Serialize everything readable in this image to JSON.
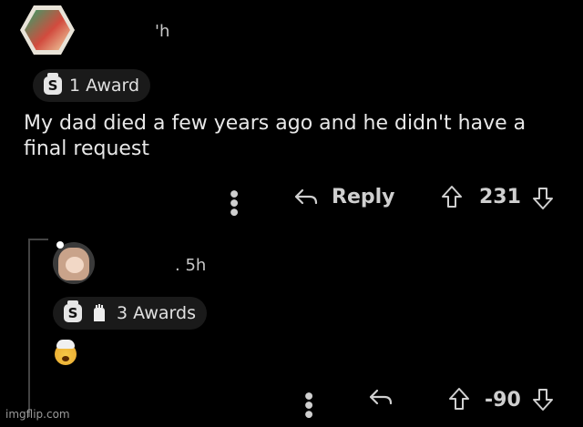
{
  "comment1": {
    "time": "'h",
    "award_count_label": "1 Award",
    "award_coin_letter": "S",
    "text_line1": "My dad died a few years ago and he didn't have a",
    "text_line2": "final request",
    "reply_label": "Reply",
    "score": "231"
  },
  "comment2": {
    "time": ". 5h",
    "award_count_label": "3 Awards",
    "award_coin_letter": "S",
    "score": "-90"
  },
  "watermark": "imgflip.com",
  "icons": {
    "more": "more-vertical-icon",
    "reply": "reply-arrow-icon",
    "upvote": "upvote-arrow-icon",
    "downvote": "downvote-arrow-icon",
    "silver_award": "silver-award-icon",
    "facepalm_award": "facepalm-award-icon",
    "mind_blown_emoji": "mind-blown-emoji-icon"
  },
  "colors": {
    "background": "#000000",
    "text": "#e6e6e6",
    "pill": "#1a1a1a",
    "thread_line": "#444444"
  }
}
